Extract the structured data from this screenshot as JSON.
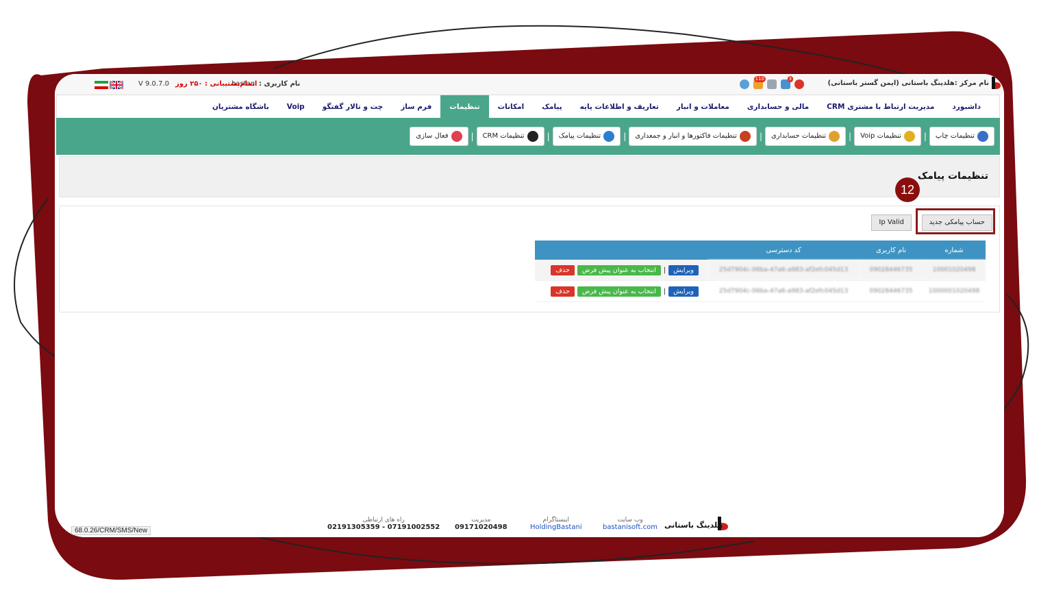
{
  "topbar": {
    "center_name": "نام مرکز :هلدینگ باستانی (ایمن گستر باستانی)",
    "notif_badge": "3",
    "ticket_badge": "110",
    "user_label": "نام کاربری :",
    "user_name": "bastani",
    "support_text": "اتمام‌پشتیبانی : ۲۵۰ روز",
    "version": "V 9.0.7.0"
  },
  "main_menu": [
    {
      "label": "داشبورد",
      "active": false
    },
    {
      "label": "مدیریت ارتباط با مشتری CRM",
      "active": false
    },
    {
      "label": "مالی و حسابداری",
      "active": false
    },
    {
      "label": "معاملات و انبار",
      "active": false
    },
    {
      "label": "تعاریف و اطلاعات پایه",
      "active": false
    },
    {
      "label": "پیامک",
      "active": false
    },
    {
      "label": "امکانات",
      "active": false
    },
    {
      "label": "تنظیمات",
      "active": true
    },
    {
      "label": "فرم ساز",
      "active": false
    },
    {
      "label": "چت و تالار گفتگو",
      "active": false
    },
    {
      "label": "Voip",
      "active": false
    },
    {
      "label": "باشگاه مشتریان",
      "active": false
    }
  ],
  "toolbar": [
    {
      "label": "تنظیمات چاپ",
      "icon": "printer-icon",
      "color": "#3a6fc4"
    },
    {
      "label": "تنظیمات Voip",
      "icon": "voip-icon",
      "color": "#e0b020"
    },
    {
      "label": "تنظیمات حسابداری",
      "icon": "money-bag-icon",
      "color": "#e0a030"
    },
    {
      "label": "تنظیمات فاکتورها و انبار و جمعداری",
      "icon": "invoice-icon",
      "color": "#c84020"
    },
    {
      "label": "تنظیمات پیامک",
      "icon": "sms-icon",
      "color": "#2a7fd0"
    },
    {
      "label": "تنظیمات CRM",
      "icon": "crm-icon",
      "color": "#222222"
    },
    {
      "label": "فعال سازی",
      "icon": "activation-icon",
      "color": "#e04050"
    }
  ],
  "page_title": "تنظیمات پیامک",
  "step_badge": "12",
  "buttons": {
    "new_account": "حساب پیامکی جدید",
    "ip_valid": "Ip Valid"
  },
  "table": {
    "headers": {
      "number": "شماره",
      "username": "نام کاربری",
      "access_code": "کد دسترسی",
      "actions": ""
    },
    "rows": [
      {
        "number": "10001020498",
        "username": "09028446735",
        "access_code": "25d7904c-06ba-47a6-a983-af2efc045d13",
        "edit": "ویرایش",
        "default": "انتخاب به عنوان پیش فرض",
        "delete": "حذف"
      },
      {
        "number": "1000001020498",
        "username": "09028446735",
        "access_code": "25d7904c-06ba-47a6-a983-af2efc045d13",
        "edit": "ویرایش",
        "default": "انتخاب به عنوان پیش فرض",
        "delete": "حذف"
      }
    ]
  },
  "footer": {
    "brand": "هلدینگ باستانی",
    "website_label": "وب سایت",
    "website": "bastanisoft.com",
    "instagram_label": "اینستاگرام",
    "instagram": "HoldingBastani",
    "manager_label": "مدیریت",
    "manager": "09171020498",
    "contact_label": "راه های ارتباطی",
    "contact": "07191002552 - 02191305359",
    "status_url": "68.0.26/CRM/SMS/New"
  },
  "colors": {
    "frame": "#7a0b10",
    "accent_green": "#4aa68a",
    "table_header": "#3f93c2",
    "highlight": "#8b1a1a"
  }
}
